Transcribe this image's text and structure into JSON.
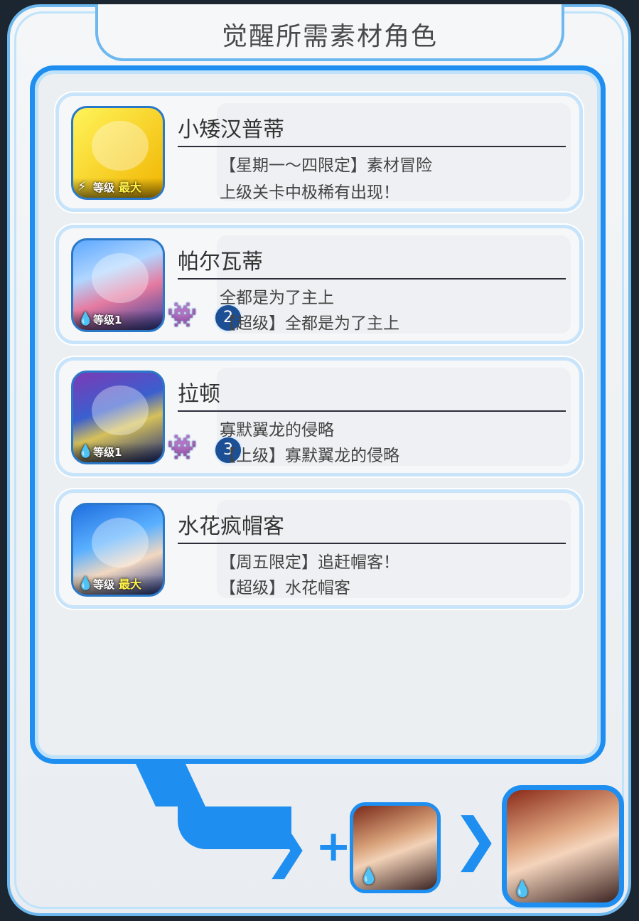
{
  "dialog": {
    "title": "觉醒所需素材角色"
  },
  "materials": [
    {
      "name": "小矮汉普蒂",
      "line1": "【星期一～四限定】素材冒险",
      "line2": "上级关卡中极稀有出现！",
      "level_label": "等级",
      "level_value": "最大",
      "element_icon": "lightning-icon",
      "count": ""
    },
    {
      "name": "帕尔瓦蒂",
      "line1": "全都是为了主上",
      "line2": "【超级】全都是为了主上",
      "level_label": "等级",
      "level_value": "1",
      "element_icon": "water-drop-icon",
      "count": "2"
    },
    {
      "name": "拉顿",
      "line1": "寡默翼龙的侵略",
      "line2": "【上级】寡默翼龙的侵略",
      "level_label": "等级",
      "level_value": "1",
      "element_icon": "water-drop-icon",
      "count": "3"
    },
    {
      "name": "水花疯帽客",
      "line1": "【周五限定】追赶帽客！",
      "line2": "【超级】水花帽客",
      "level_label": "等级",
      "level_value": "最大",
      "element_icon": "water-drop-icon",
      "count": ""
    }
  ],
  "colors": {
    "accent_blue": "#1e8ff0",
    "panel_border": "#6db8ee"
  }
}
